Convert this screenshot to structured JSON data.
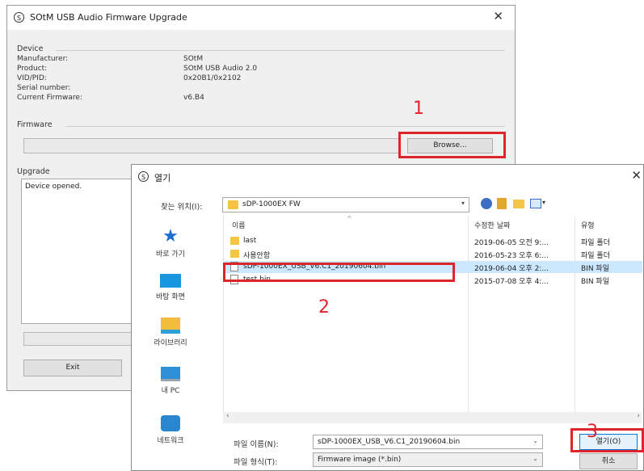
{
  "upgrade_window": {
    "title": "SOtM USB Audio Firmware Upgrade",
    "close_glyph": "✕",
    "device": {
      "label": "Device",
      "rows": [
        {
          "key": "Manufacturer:",
          "value": "SOtM"
        },
        {
          "key": "Product:",
          "value": "SOtM USB Audio 2.0"
        },
        {
          "key": "VID/PID:",
          "value": "0x20B1/0x2102"
        },
        {
          "key": "Serial number:",
          "value": ""
        },
        {
          "key": "Current Firmware:",
          "value": "v6.B4"
        }
      ]
    },
    "firmware": {
      "label": "Firmware",
      "browse_label": "Browse..."
    },
    "upgrade": {
      "label": "Upgrade",
      "log": "Device opened."
    },
    "exit_label": "Exit"
  },
  "open_dialog": {
    "title": "열기",
    "close_glyph": "✕",
    "lookin": {
      "label": "찾는 위치(I):",
      "value": "sDP-1000EX FW"
    },
    "columns": {
      "name": "이름",
      "date": "수정한 날짜",
      "type": "유형"
    },
    "sidebar": [
      {
        "label": "바로 가기",
        "icon": "star-icon"
      },
      {
        "label": "바탕 화면",
        "icon": "desktop-icon"
      },
      {
        "label": "라이브러리",
        "icon": "library-icon"
      },
      {
        "label": "내 PC",
        "icon": "pc-icon"
      },
      {
        "label": "네트워크",
        "icon": "network-icon"
      }
    ],
    "files": [
      {
        "name": "last",
        "date": "2019-06-05 오전 9:...",
        "type": "파일 폴더",
        "kind": "folder"
      },
      {
        "name": "사용안함",
        "date": "2016-05-23 오후 6:...",
        "type": "파일 폴더",
        "kind": "folder"
      },
      {
        "name": "sDP-1000EX_USB_V6.C1_20190604.bin",
        "date": "2019-06-04 오후 2:...",
        "type": "BIN 파일",
        "kind": "file"
      },
      {
        "name": "test.bin",
        "date": "2015-07-08 오후 4:...",
        "type": "BIN 파일",
        "kind": "file"
      }
    ],
    "filename": {
      "label": "파일 이름(N):",
      "value": "sDP-1000EX_USB_V6.C1_20190604.bin"
    },
    "filetype": {
      "label": "파일 형식(T):",
      "value": "Firmware image (*.bin)"
    },
    "open_label": "열기(O)",
    "cancel_label": "취소"
  },
  "annotations": {
    "step1": "1",
    "step2": "2",
    "step3": "3"
  },
  "colors": {
    "accent": "#e0242c",
    "selection": "#cce8ff"
  }
}
